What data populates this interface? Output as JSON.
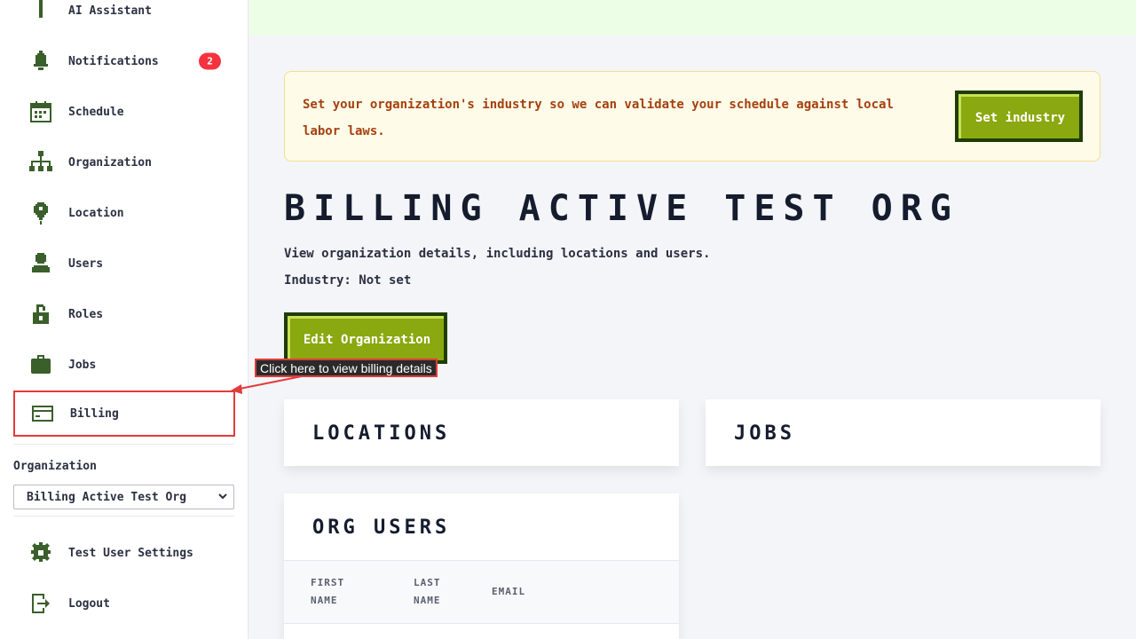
{
  "sidebar": {
    "items": [
      {
        "label": "AI Assistant",
        "icon": "ai-assistant-icon"
      },
      {
        "label": "Notifications",
        "icon": "bell-icon",
        "badge": "2"
      },
      {
        "label": "Schedule",
        "icon": "calendar-icon"
      },
      {
        "label": "Organization",
        "icon": "org-chart-icon"
      },
      {
        "label": "Location",
        "icon": "location-pin-icon"
      },
      {
        "label": "Users",
        "icon": "user-icon"
      },
      {
        "label": "Roles",
        "icon": "lock-icon"
      },
      {
        "label": "Jobs",
        "icon": "briefcase-icon"
      },
      {
        "label": "Billing",
        "icon": "credit-card-icon"
      }
    ],
    "org_label": "Organization",
    "org_select_value": "Billing Active Test Org",
    "bottom_items": [
      {
        "label": "Test User Settings",
        "icon": "gear-icon"
      },
      {
        "label": "Logout",
        "icon": "logout-icon"
      }
    ]
  },
  "banner": {
    "text": "Set your organization's industry so we can validate your schedule against local labor laws.",
    "button_label": "Set industry"
  },
  "page": {
    "title": "BILLING ACTIVE TEST ORG",
    "subtitle": "View organization details, including locations and users.",
    "industry": "Industry: Not set",
    "edit_button": "Edit Organization"
  },
  "tooltip": "Click here to view billing details",
  "cards": {
    "locations": "LOCATIONS",
    "jobs": "JOBS",
    "org_users": "ORG USERS",
    "columns": [
      "FIRST NAME",
      "LAST NAME",
      "EMAIL"
    ]
  },
  "colors": {
    "accent_green": "#8aa80f",
    "dark_green": "#1f3d06",
    "icon_green": "#3a5f2b",
    "badge_red": "#f5333f",
    "highlight_red": "#e23b3b",
    "banner_text": "#a5400e"
  }
}
